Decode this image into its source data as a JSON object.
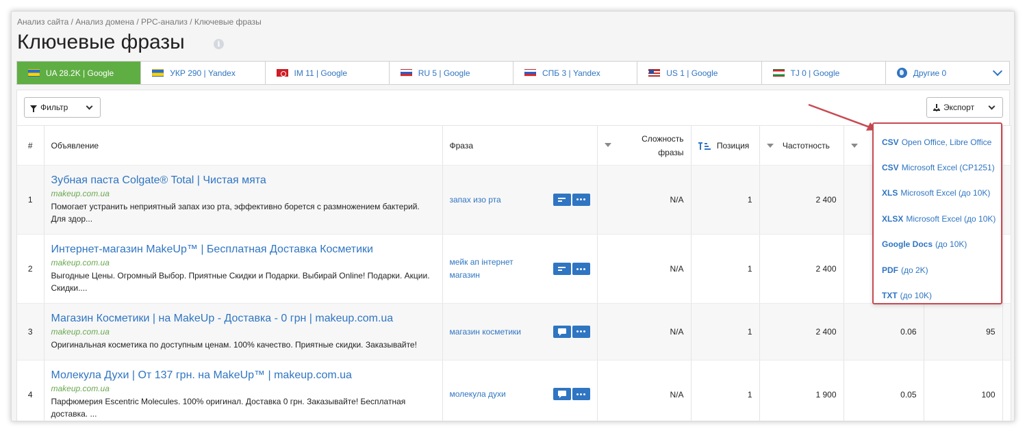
{
  "breadcrumb": "Анализ сайта / Анализ домена / PPC-анализ / Ключевые фразы",
  "page_title": "Ключевые фразы",
  "tabs": [
    {
      "label": "UA 28.2K | Google",
      "flag": "ua",
      "active": true
    },
    {
      "label": "УКР 290 | Yandex",
      "flag": "ua"
    },
    {
      "label": "IM 11 | Google",
      "flag": "im"
    },
    {
      "label": "RU 5 | Google",
      "flag": "ru"
    },
    {
      "label": "СПБ 3 | Yandex",
      "flag": "ru"
    },
    {
      "label": "US 1 | Google",
      "flag": "us"
    },
    {
      "label": "TJ 0 | Google",
      "flag": "tj"
    },
    {
      "label": "Другие 0",
      "icon": "globe-icon"
    }
  ],
  "toolbar": {
    "filter_label": "Фильтр",
    "export_label": "Экспорт"
  },
  "table": {
    "headers": {
      "num": "#",
      "ad": "Объявление",
      "phrase": "Фраза",
      "difficulty_line1": "Сложность",
      "difficulty_line2": "фразы",
      "position": "Позиция",
      "frequency": "Частотность"
    },
    "rows": [
      {
        "num": "1",
        "title": "Зубная паста Colgate® Total | Чистая мята",
        "url": "makeup.com.ua",
        "desc": "Помогает устранить неприятный запах изо рта, эффективно борется с размножением бактерий. Для здор...",
        "phrase": "запах изо рта",
        "btn": "lines",
        "difficulty": "N/A",
        "position": "1",
        "frequency": "2 400",
        "col8": "",
        "col9": ""
      },
      {
        "num": "2",
        "title": "Интернет-магазин MakeUp™ | Бесплатная Доставка Косметики",
        "url": "makeup.com.ua",
        "desc": "Выгодные Цены. Огромный Выбор. Приятные Скидки и Подарки. Выбирай Online! Подарки. Акции. Скидки....",
        "phrase": "мейк ап інтернет магазин",
        "btn": "lines",
        "difficulty": "N/A",
        "position": "1",
        "frequency": "2 400",
        "col8": "",
        "col9": ""
      },
      {
        "num": "3",
        "title": "Магазин Косметики | на MakeUp - Доставка - 0 грн | makeup.com.ua",
        "url": "makeup.com.ua",
        "desc": "Оригинальная косметика по доступным ценам. 100% качество. Приятные скидки. Заказывайте!",
        "phrase": "магазин косметики",
        "btn": "chat",
        "difficulty": "N/A",
        "position": "1",
        "frequency": "2 400",
        "col8": "0.06",
        "col9": "95"
      },
      {
        "num": "4",
        "title": "Молекула Духи | От 137 грн. на MakeUp™ | makeup.com.ua",
        "url": "makeup.com.ua",
        "desc": "Парфюмерия Escentric Molecules. 100% оригинал. Доставка 0 грн. Заказывайте! Бесплатная доставка. ...",
        "phrase": "молекула духи",
        "btn": "chat",
        "difficulty": "N/A",
        "position": "1",
        "frequency": "1 900",
        "col8": "0.05",
        "col9": "100"
      }
    ]
  },
  "export_menu": [
    {
      "bold": "CSV",
      "rest": "Open Office, Libre Office"
    },
    {
      "bold": "CSV",
      "rest": "Microsoft Excel (CP1251)"
    },
    {
      "bold": "XLS",
      "rest": "Microsoft Excel (до 10K)"
    },
    {
      "bold": "XLSX",
      "rest": "Microsoft Excel (до 10K)"
    },
    {
      "bold": "Google Docs",
      "rest": "(до 10K)"
    },
    {
      "bold": "PDF",
      "rest": "(до 2K)"
    },
    {
      "bold": "TXT",
      "rest": "(до 10K)"
    }
  ],
  "colors": {
    "accent": "#2f75c2",
    "active_tab": "#5fae44",
    "url_green": "#6aa84f",
    "highlight_red": "#c84a52"
  }
}
